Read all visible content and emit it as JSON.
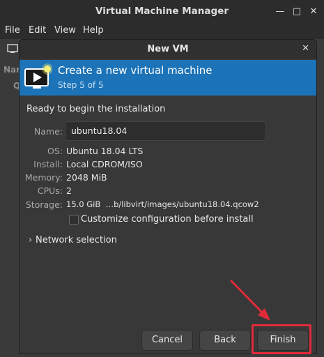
{
  "window": {
    "title": "Virtual Machine Manager",
    "minimize_glyph": "—",
    "maximize_glyph": "□",
    "close_glyph": "✕"
  },
  "menubar": {
    "items": [
      "File",
      "Edit",
      "View",
      "Help"
    ]
  },
  "background_labels": {
    "name_fragment": "Nam",
    "q_fragment": "Q"
  },
  "dialog": {
    "title": "New VM",
    "close_glyph": "✕",
    "banner": {
      "title": "Create a new virtual machine",
      "step": "Step 5 of 5",
      "icon": "monitor-play-icon",
      "color": "#1d73b7"
    },
    "ready_text": "Ready to begin the installation",
    "fields": {
      "name_label": "Name:",
      "name_value": "ubuntu18.04",
      "os_label": "OS:",
      "os_value": "Ubuntu 18.04 LTS",
      "install_label": "Install:",
      "install_value": "Local CDROM/ISO",
      "memory_label": "Memory:",
      "memory_value": "2048 MiB",
      "cpus_label": "CPUs:",
      "cpus_value": "2",
      "storage_label": "Storage:",
      "storage_value": "15.0 GiB  …b/libvirt/images/ubuntu18.04.qcow2"
    },
    "customize_label": "Customize configuration before install",
    "customize_checked": false,
    "network_label": "Network selection",
    "buttons": {
      "cancel": "Cancel",
      "back": "Back",
      "finish": "Finish"
    }
  },
  "annotation": {
    "highlight_color": "#e02a3a",
    "arrow_color": "#e02a3a"
  }
}
